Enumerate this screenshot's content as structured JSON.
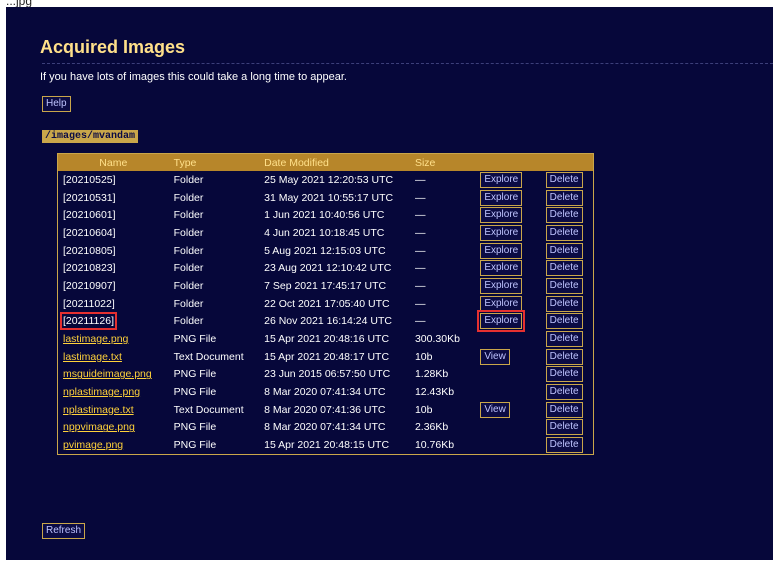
{
  "window": {
    "top_caption": "...jpg"
  },
  "page": {
    "title": "Acquired Images",
    "subtitle": "If you have lots of images this could take a long time to appear.",
    "help_label": "Help",
    "path": "/images/mvandam",
    "refresh_label": "Refresh"
  },
  "table": {
    "headers": [
      "Name",
      "Type",
      "Date Modified",
      "Size"
    ],
    "rows": [
      {
        "name": "[20210525]",
        "type": "Folder",
        "date": "25 May 2021 12:20:53 UTC",
        "size": "—",
        "action": "Explore",
        "delete": "Delete"
      },
      {
        "name": "[20210531]",
        "type": "Folder",
        "date": "31 May 2021 10:55:17 UTC",
        "size": "—",
        "action": "Explore",
        "delete": "Delete"
      },
      {
        "name": "[20210601]",
        "type": "Folder",
        "date": "1 Jun 2021 10:40:56 UTC",
        "size": "—",
        "action": "Explore",
        "delete": "Delete"
      },
      {
        "name": "[20210604]",
        "type": "Folder",
        "date": "4 Jun 2021 10:18:45 UTC",
        "size": "—",
        "action": "Explore",
        "delete": "Delete"
      },
      {
        "name": "[20210805]",
        "type": "Folder",
        "date": "5 Aug 2021 12:15:03 UTC",
        "size": "—",
        "action": "Explore",
        "delete": "Delete"
      },
      {
        "name": "[20210823]",
        "type": "Folder",
        "date": "23 Aug 2021 12:10:42 UTC",
        "size": "—",
        "action": "Explore",
        "delete": "Delete"
      },
      {
        "name": "[20210907]",
        "type": "Folder",
        "date": "7 Sep 2021 17:45:17 UTC",
        "size": "—",
        "action": "Explore",
        "delete": "Delete"
      },
      {
        "name": "[20211022]",
        "type": "Folder",
        "date": "22 Oct 2021 17:05:40 UTC",
        "size": "—",
        "action": "Explore",
        "delete": "Delete"
      },
      {
        "name": "[20211126]",
        "type": "Folder",
        "date": "26 Nov 2021 16:14:24 UTC",
        "size": "—",
        "action": "Explore",
        "delete": "Delete"
      },
      {
        "name": "lastimage.png",
        "type": "PNG File",
        "date": "15 Apr 2021 20:48:16 UTC",
        "size": "300.30Kb",
        "action": "",
        "delete": "Delete"
      },
      {
        "name": "lastimage.txt",
        "type": "Text Document",
        "date": "15 Apr 2021 20:48:17 UTC",
        "size": "10b",
        "action": "View",
        "delete": "Delete"
      },
      {
        "name": "msguideimage.png",
        "type": "PNG File",
        "date": "23 Jun 2015 06:57:50 UTC",
        "size": "1.28Kb",
        "action": "",
        "delete": "Delete"
      },
      {
        "name": "nplastimage.png",
        "type": "PNG File",
        "date": "8 Mar 2020 07:41:34 UTC",
        "size": "12.43Kb",
        "action": "",
        "delete": "Delete"
      },
      {
        "name": "nplastimage.txt",
        "type": "Text Document",
        "date": "8 Mar 2020 07:41:36 UTC",
        "size": "10b",
        "action": "View",
        "delete": "Delete"
      },
      {
        "name": "nppvimage.png",
        "type": "PNG File",
        "date": "8 Mar 2020 07:41:34 UTC",
        "size": "2.36Kb",
        "action": "",
        "delete": "Delete"
      },
      {
        "name": "pvimage.png",
        "type": "PNG File",
        "date": "15 Apr 2021 20:48:15 UTC",
        "size": "10.76Kb",
        "action": "",
        "delete": "Delete"
      }
    ]
  },
  "colors": {
    "background": "#06073a",
    "accent": "#c9a64a",
    "link": "#ffd23a",
    "highlight": "#e53030"
  }
}
